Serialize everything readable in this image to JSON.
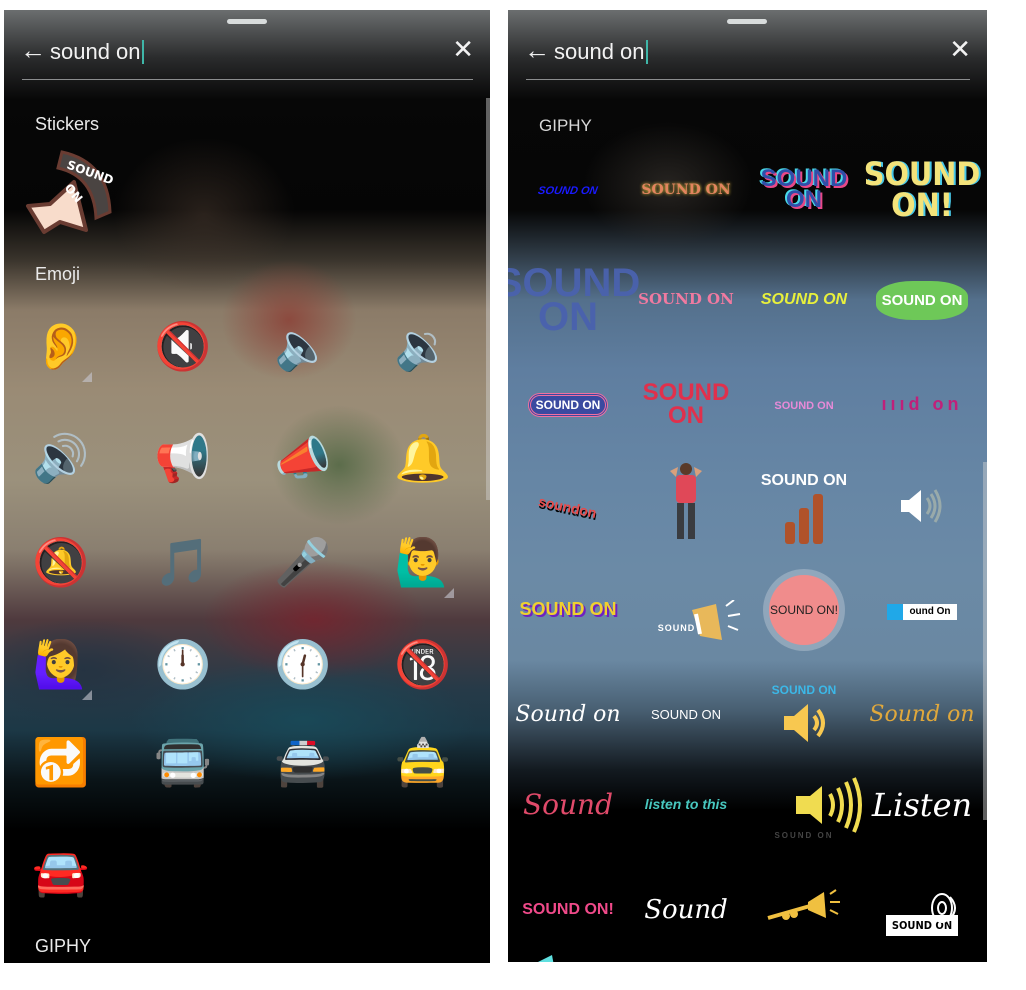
{
  "left": {
    "search": {
      "back_icon": "←",
      "query": "sound on",
      "clear_icon": "✕"
    },
    "sections": {
      "stickers": "Stickers",
      "emoji": "Emoji",
      "giphy": "GIPHY"
    },
    "sticker_items": [
      {
        "name": "sound-on-speaker-sticker",
        "text_line1": "SOUND",
        "text_line2": "ON"
      }
    ],
    "emoji_items": [
      {
        "name": "ear",
        "glyph": "👂",
        "has_variants": true
      },
      {
        "name": "muted-speaker",
        "glyph": "🔇",
        "has_variants": false
      },
      {
        "name": "speaker-low-volume",
        "glyph": "🔈",
        "has_variants": false
      },
      {
        "name": "speaker-medium-volume",
        "glyph": "🔉",
        "has_variants": false
      },
      {
        "name": "speaker-high-volume",
        "glyph": "🔊",
        "has_variants": false
      },
      {
        "name": "loudspeaker",
        "glyph": "📢",
        "has_variants": false
      },
      {
        "name": "megaphone",
        "glyph": "📣",
        "has_variants": false
      },
      {
        "name": "bell",
        "glyph": "🔔",
        "has_variants": false
      },
      {
        "name": "bell-with-slash",
        "glyph": "🔕",
        "has_variants": false
      },
      {
        "name": "musical-note",
        "glyph": "🎵",
        "has_variants": false
      },
      {
        "name": "microphone",
        "glyph": "🎤",
        "has_variants": false
      },
      {
        "name": "man-raising-hand",
        "glyph": "🙋‍♂️",
        "has_variants": true
      },
      {
        "name": "woman-raising-hand",
        "glyph": "🙋‍♀️",
        "has_variants": true
      },
      {
        "name": "twelve-oclock",
        "glyph": "🕛",
        "has_variants": false
      },
      {
        "name": "twelve-thirty",
        "glyph": "🕧",
        "has_variants": false
      },
      {
        "name": "no-one-under-eighteen",
        "glyph": "🔞",
        "has_variants": false
      },
      {
        "name": "repeat-single",
        "glyph": "🔂",
        "has_variants": false
      },
      {
        "name": "oncoming-bus",
        "glyph": "🚍",
        "has_variants": false
      },
      {
        "name": "oncoming-police-car",
        "glyph": "🚔",
        "has_variants": false
      },
      {
        "name": "oncoming-taxi",
        "glyph": "🚖",
        "has_variants": false
      },
      {
        "name": "oncoming-automobile",
        "glyph": "🚘",
        "has_variants": false
      }
    ]
  },
  "right": {
    "search": {
      "back_icon": "←",
      "query": "sound on",
      "clear_icon": "✕"
    },
    "sections": {
      "giphy": "GIPHY"
    },
    "giphy_items": [
      {
        "name": "sound-on-blue-wavy",
        "text": "SOUND ON",
        "color": "#1a1aff"
      },
      {
        "name": "sound-on-sparkles",
        "text": "SOUND ON",
        "color": "#e2845f"
      },
      {
        "name": "sound-on-3d-blue",
        "text": "SOUND ON",
        "color": "#2f4ea8"
      },
      {
        "name": "sound-on-striped",
        "text": "SOUND ON!",
        "color": "#f3e37b"
      },
      {
        "name": "sound-on-big-blue",
        "text": "SOUND ON",
        "color": "#4a62ae"
      },
      {
        "name": "sound-on-gradient-pink",
        "text": "SOUND ON",
        "color": "#f07aa0"
      },
      {
        "name": "sound-on-yellow",
        "text": "SOUND ON",
        "color": "#e8f03c"
      },
      {
        "name": "sound-on-green-burst",
        "text": "SOUND ON",
        "color": "#6ec858"
      },
      {
        "name": "sound-on-outline-badge",
        "text": "SOUND ON",
        "color": "#ffffff"
      },
      {
        "name": "sound-on-gramophone",
        "text": "SOUND ON",
        "color": "#e0304c"
      },
      {
        "name": "sound-on-singer",
        "text": "SOUND ON",
        "color": "#e88ad8"
      },
      {
        "name": "sound-on-magenta-bars",
        "text": "ıııd on",
        "color": "#c0207a"
      },
      {
        "name": "sound-on-3d-red",
        "text": "soundon",
        "color": "#e84a4a"
      },
      {
        "name": "sound-on-shouting-man",
        "text": "",
        "color": "#d84050"
      },
      {
        "name": "sound-on-bars",
        "text": "SOUND ON",
        "color": "#ffffff"
      },
      {
        "name": "speaker-white",
        "text": "",
        "color": "#ffffff"
      },
      {
        "name": "sound-on-purple-speaker",
        "text": "SOUND ON",
        "color": "#f0d030"
      },
      {
        "name": "sound-on-megaphone-yellow",
        "text": "SOUND ON",
        "color": "#ffffff"
      },
      {
        "name": "sound-on-pink-circle",
        "text": "SOUND ON!",
        "color": "#f08c8c"
      },
      {
        "name": "sound-on-blue-label",
        "text": "ound On",
        "color": "#000000"
      },
      {
        "name": "sound-on-bird-white",
        "text": "Sound on",
        "color": "#ffffff"
      },
      {
        "name": "sound-on-handwritten",
        "text": "SOUND ON",
        "color": "#ffffff"
      },
      {
        "name": "sound-on-yellow-speaker",
        "text": "SOUND ON",
        "color": "#3cb8e8"
      },
      {
        "name": "sound-on-bird-gold",
        "text": "Sound on",
        "color": "#e0a83c"
      },
      {
        "name": "sound-pink-script",
        "text": "Sound",
        "color": "#e04a6a"
      },
      {
        "name": "listen-to-this",
        "text": "listen to this",
        "color": "#48c8c0"
      },
      {
        "name": "speaker-yellow-waves",
        "text": "SOUND ON",
        "color": "#f0dc50"
      },
      {
        "name": "listen-script",
        "text": "Listen",
        "color": "#ffffff"
      },
      {
        "name": "sound-on-megaphone-pink",
        "text": "SOUND ON!",
        "color": "#f04a8a"
      },
      {
        "name": "sound-white-script",
        "text": "Sound",
        "color": "#ffffff"
      },
      {
        "name": "trumpet",
        "text": "",
        "color": "#f0c040"
      },
      {
        "name": "sound-on-speaker-label",
        "text": "SOUND ON",
        "color": "#000000"
      }
    ]
  }
}
